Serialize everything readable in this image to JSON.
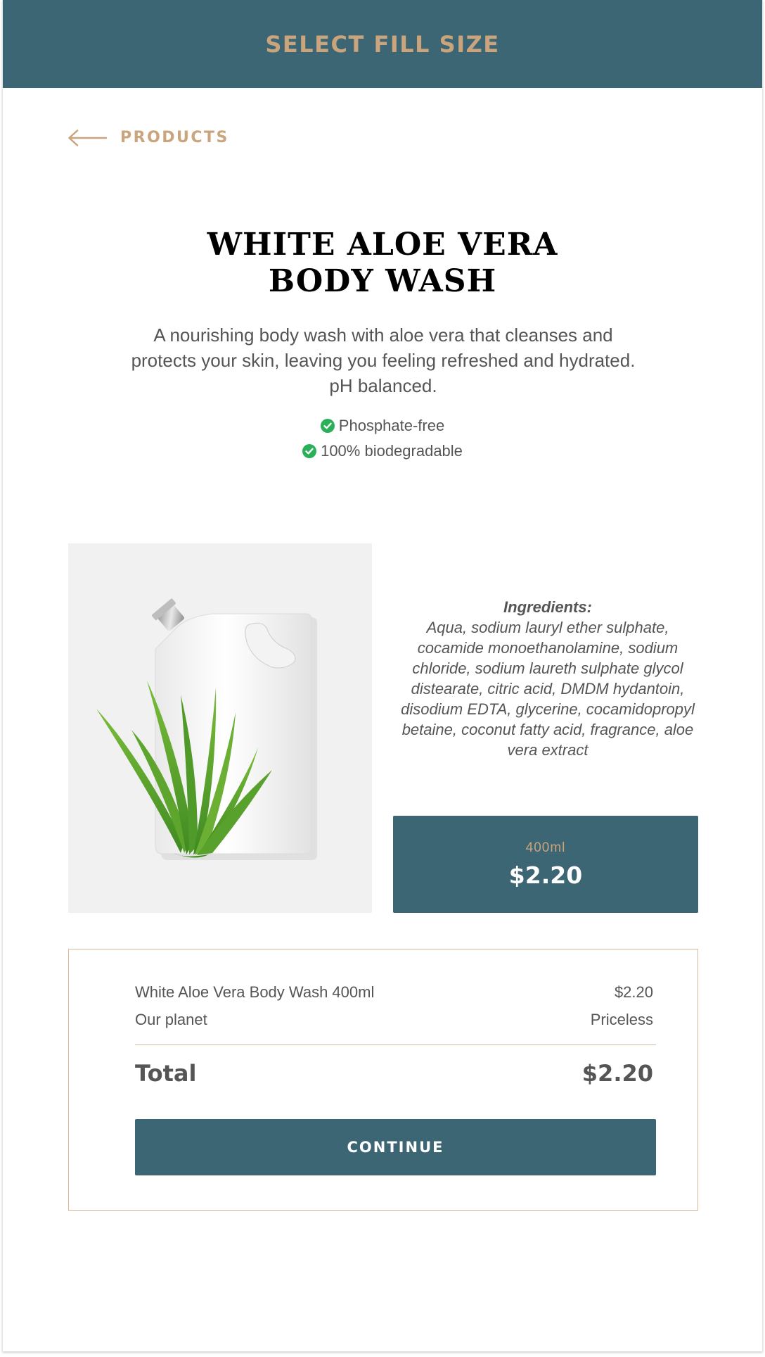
{
  "header": {
    "title": "SELECT FILL SIZE"
  },
  "nav": {
    "back_label": "PRODUCTS",
    "back_icon": "arrow-left-icon"
  },
  "product": {
    "title_line1": "WHITE ALOE VERA",
    "title_line2": "BODY WASH",
    "description": "A nourishing body wash with aloe vera that cleanses and protects your skin, leaving you feeling refreshed and hydrated. pH balanced.",
    "features": [
      {
        "label": "Phosphate-free",
        "icon": "check-circle-icon"
      },
      {
        "label": "100% biodegradable",
        "icon": "check-circle-icon"
      }
    ],
    "ingredients_label": "Ingredients:",
    "ingredients": "Aqua, sodium lauryl ether sulphate, cocamide monoethanolamine, sodium chloride, sodium laureth sulphate glycol distearate, citric acid, DMDM hydantoin, disodium EDTA, glycerine, cocamidopropyl betaine, coconut fatty acid, fragrance, aloe vera extract"
  },
  "size_option": {
    "size": "400ml",
    "price": "$2.20"
  },
  "summary": {
    "lines": [
      {
        "label": "White Aloe Vera Body Wash 400ml",
        "value": "$2.20"
      },
      {
        "label": "Our planet",
        "value": "Priceless"
      }
    ],
    "total_label": "Total",
    "total_value": "$2.20",
    "continue_label": "CONTINUE"
  },
  "colors": {
    "primary": "#3d6674",
    "accent": "#c9a47c",
    "check": "#2bb05a",
    "text": "#555555"
  }
}
